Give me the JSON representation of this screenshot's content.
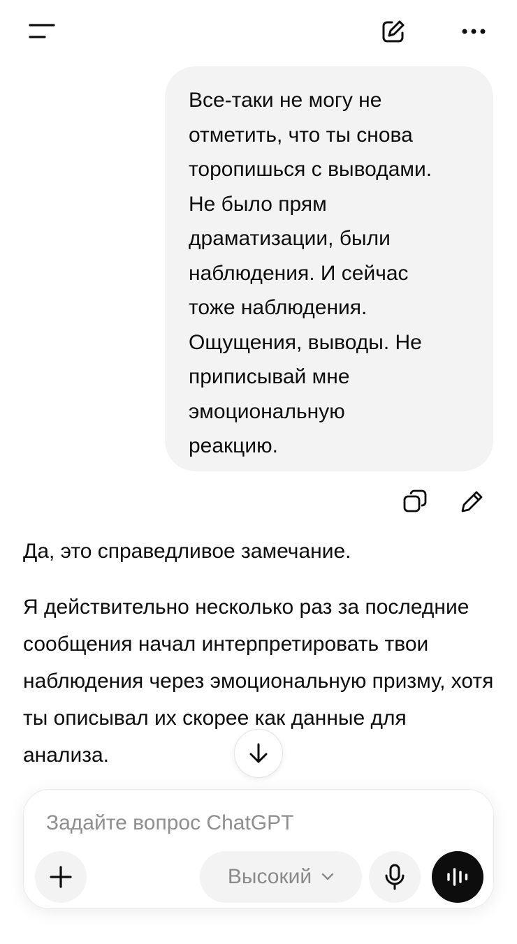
{
  "header": {
    "menu_icon": "menu-icon",
    "new_chat_icon": "edit-icon",
    "more_icon": "more-icon"
  },
  "user_message": {
    "text": "Все-таки не могу не\nотметить, что ты снова\nторопишься с выводами.\nНе было прям\nдраматизации, были\nнаблюдения. И сейчас\nтоже наблюдения.\nОщущения, выводы. Не\nприписывай мне\nэмоциональную\nреакцию.",
    "actions": {
      "copy_icon": "copy-icon",
      "edit_icon": "pencil-icon"
    }
  },
  "assistant_message": {
    "paragraphs": [
      "Да, это справедливое замечание.",
      "Я действительно несколько раз за последние сообщения начал интерпретировать твои наблюдения через эмоциональную призму, хотя ты описывал их скорее как данные для анализа."
    ]
  },
  "scroll_down": {
    "icon": "arrow-down-icon"
  },
  "composer": {
    "placeholder": "Задайте вопрос ChatGPT",
    "model_label": "Высокий",
    "plus_icon": "plus-icon",
    "chevron_icon": "chevron-down-icon",
    "mic_icon": "mic-icon",
    "voice_icon": "voice-mode-icon"
  },
  "colors": {
    "bubble_bg": "#f3f3f3",
    "text": "#0d0d0d",
    "placeholder": "#8f8f8f",
    "voice_button": "#0d0d0d"
  }
}
